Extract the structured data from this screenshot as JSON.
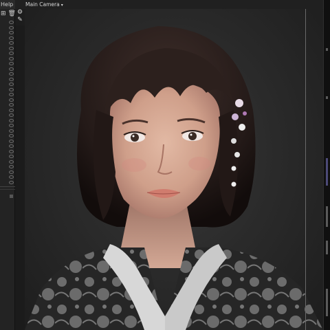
{
  "menu": {
    "help_label": "Help"
  },
  "outliner": {
    "toolbar_icons": [
      "add-icon",
      "trash-icon"
    ],
    "visibility_rows": 32
  },
  "viewport": {
    "tools": [
      "gear-icon",
      "brush-icon"
    ],
    "camera_label": "Main Camera",
    "camera_dropdown_icon": "chevron-down-icon"
  },
  "colors": {
    "background": "#1b1b1b",
    "panel": "#232323",
    "viewport_bg": "#2b2b2b"
  }
}
